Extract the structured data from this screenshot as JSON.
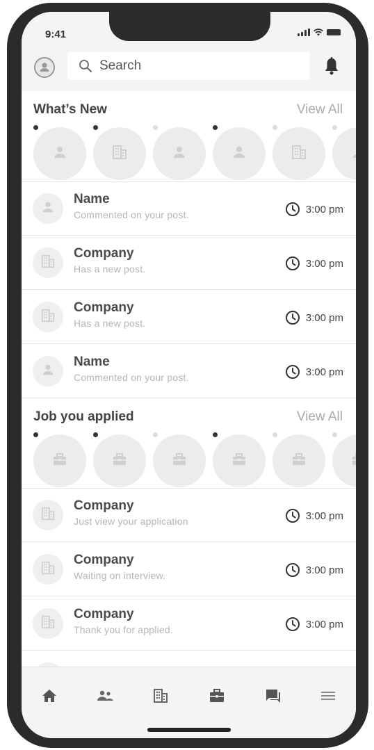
{
  "status_bar": {
    "time": "9:41"
  },
  "header": {
    "search_placeholder": "Search"
  },
  "whats_new": {
    "title": "What’s New",
    "view_all": "View All",
    "stories": [
      {
        "type": "person",
        "unread": true
      },
      {
        "type": "company",
        "unread": true
      },
      {
        "type": "person",
        "unread": false
      },
      {
        "type": "person",
        "unread": true
      },
      {
        "type": "company",
        "unread": false
      },
      {
        "type": "person",
        "unread": false
      }
    ]
  },
  "activity": [
    {
      "type": "person",
      "title": "Name",
      "subtitle": "Commented on your post.",
      "time": "3:00 pm"
    },
    {
      "type": "company",
      "title": "Company",
      "subtitle": "Has a new post.",
      "time": "3:00 pm"
    },
    {
      "type": "company",
      "title": "Company",
      "subtitle": "Has a new post.",
      "time": "3:00 pm"
    },
    {
      "type": "person",
      "title": "Name",
      "subtitle": "Commented on your post.",
      "time": "3:00 pm"
    }
  ],
  "jobs_applied": {
    "title": "Job you applied",
    "view_all": "View All",
    "stories": [
      {
        "type": "job",
        "unread": true
      },
      {
        "type": "job",
        "unread": true
      },
      {
        "type": "job",
        "unread": false
      },
      {
        "type": "job",
        "unread": true
      },
      {
        "type": "job",
        "unread": false
      },
      {
        "type": "job",
        "unread": false
      }
    ]
  },
  "job_updates": [
    {
      "type": "company",
      "title": "Company",
      "subtitle": "Just view your application",
      "time": "3:00 pm"
    },
    {
      "type": "company",
      "title": "Company",
      "subtitle": "Waiting on interview.",
      "time": "3:00 pm"
    },
    {
      "type": "company",
      "title": "Company",
      "subtitle": "Thank you for applied.",
      "time": "3:00 pm"
    }
  ],
  "bottom_nav": [
    "home-icon",
    "people-icon",
    "company-icon",
    "briefcase-icon",
    "chat-icon",
    "menu-icon"
  ],
  "colors": {
    "placeholder_bg": "#ececec",
    "icon_gray": "#cfcfcf",
    "text_dark": "#4a4a4a",
    "text_light": "#b5b5b5",
    "frame": "#2b2b2b"
  }
}
